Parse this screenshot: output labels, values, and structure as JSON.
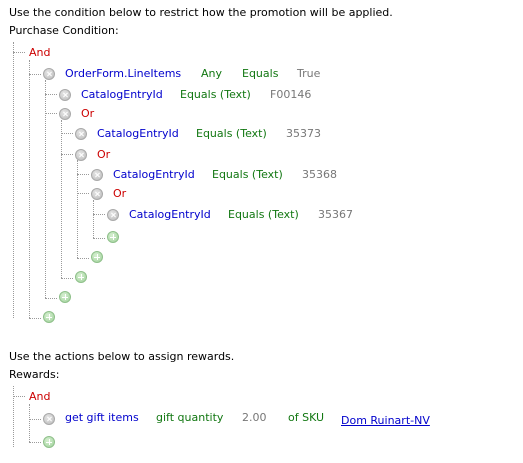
{
  "purchase": {
    "instruction": "Use the condition below to restrict how the promotion will be applied.",
    "heading": "Purchase Condition:",
    "root_op": "And",
    "lineitems": {
      "field": "OrderForm.LineItems",
      "quant": "Any",
      "op": "Equals",
      "value": "True"
    },
    "entry1": {
      "field": "CatalogEntryId",
      "op": "Equals (Text)",
      "value": "F00146"
    },
    "or1": "Or",
    "entry2": {
      "field": "CatalogEntryId",
      "op": "Equals (Text)",
      "value": "35373"
    },
    "or2": "Or",
    "entry3": {
      "field": "CatalogEntryId",
      "op": "Equals (Text)",
      "value": "35368"
    },
    "or3": "Or",
    "entry4": {
      "field": "CatalogEntryId",
      "op": "Equals (Text)",
      "value": "35367"
    }
  },
  "rewards": {
    "instruction": "Use the actions below to assign rewards.",
    "heading": "Rewards:",
    "root_op": "And",
    "action": {
      "name": "get gift items",
      "param": "gift quantity",
      "qty": "2.00",
      "of": "of SKU",
      "sku": "Dom Ruinart-NV"
    }
  },
  "icons": {
    "remove": "remove-icon",
    "add": "add-icon"
  },
  "colors": {
    "operator": "#cc0000",
    "field": "#0000cc",
    "condition": "#117711",
    "value": "#777777"
  }
}
